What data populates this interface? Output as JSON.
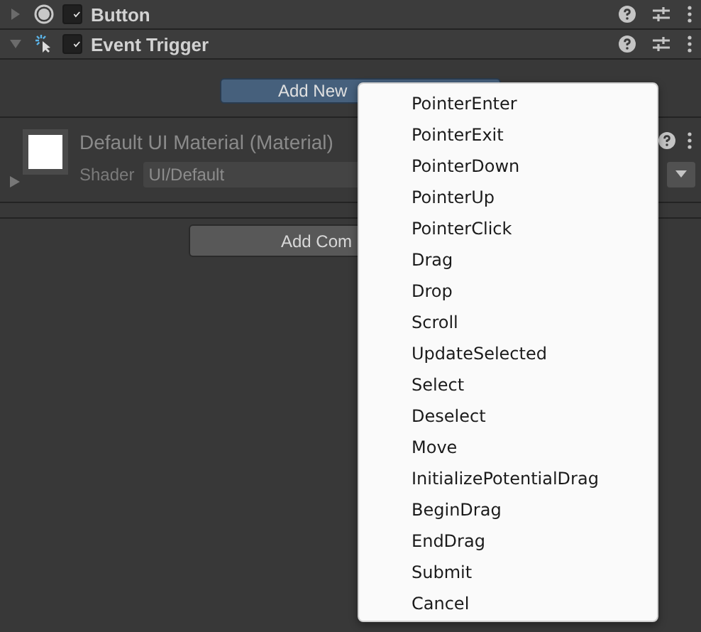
{
  "components": [
    {
      "title": "Button",
      "kind": "button",
      "expanded": false,
      "enabled": true
    },
    {
      "title": "Event Trigger",
      "kind": "trigger",
      "expanded": true,
      "enabled": true
    }
  ],
  "add_new_button": "Add New",
  "material": {
    "title": "Default UI Material (Material)",
    "expanded": false,
    "shader_label": "Shader",
    "shader_value": "UI/Default"
  },
  "add_component_button": "Add Com",
  "menu": {
    "items": [
      {
        "label": "PointerEnter"
      },
      {
        "label": "PointerExit"
      },
      {
        "label": "PointerDown"
      },
      {
        "label": "PointerUp"
      },
      {
        "label": "PointerClick"
      },
      {
        "label": "Drag"
      },
      {
        "label": "Drop"
      },
      {
        "label": "Scroll"
      },
      {
        "label": "UpdateSelected"
      },
      {
        "label": "Select"
      },
      {
        "label": "Deselect"
      },
      {
        "label": "Move"
      },
      {
        "label": "InitializePotentialDrag"
      },
      {
        "label": "BeginDrag"
      },
      {
        "label": "EndDrag"
      },
      {
        "label": "Submit"
      },
      {
        "label": "Cancel"
      }
    ]
  }
}
